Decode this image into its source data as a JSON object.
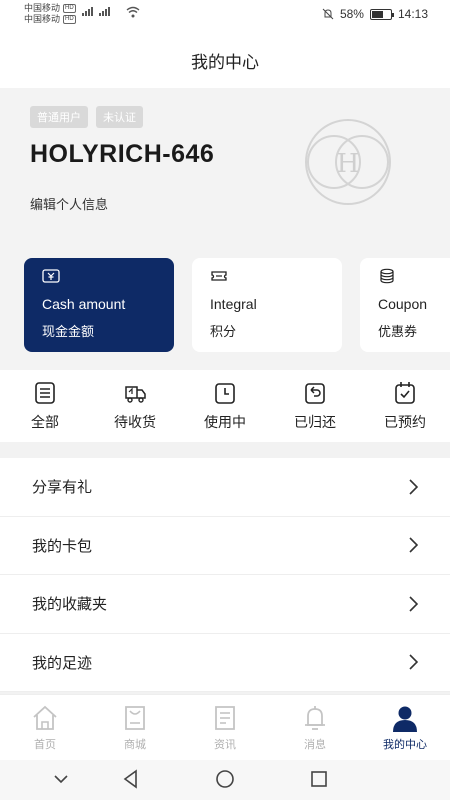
{
  "status_bar": {
    "carrier_1": "中国移动",
    "carrier_2": "中国移动",
    "hd": "HD",
    "net": "4G",
    "battery_percent": "58%",
    "time": "14:13"
  },
  "header": {
    "title": "我的中心"
  },
  "profile": {
    "tags": [
      "普通用户",
      "未认证"
    ],
    "username": "HOLYRICH-646",
    "edit_label": "编辑个人信息",
    "logo_letter": "H"
  },
  "cards": [
    {
      "en": "Cash amount",
      "cn": "现金金额",
      "icon": "yen-ticket-icon",
      "active": true
    },
    {
      "en": "Integral",
      "cn": "积分",
      "icon": "ticket-icon",
      "active": false
    },
    {
      "en": "Coupon",
      "cn": "优惠券",
      "icon": "coins-icon",
      "active": false
    }
  ],
  "orders": [
    {
      "label": "全部",
      "icon": "list-icon"
    },
    {
      "label": "待收货",
      "icon": "truck-icon"
    },
    {
      "label": "使用中",
      "icon": "clock-icon"
    },
    {
      "label": "已归还",
      "icon": "return-icon"
    },
    {
      "label": "已预约",
      "icon": "calendar-check-icon"
    }
  ],
  "menu": [
    {
      "label": "分享有礼"
    },
    {
      "label": "我的卡包"
    },
    {
      "label": "我的收藏夹"
    },
    {
      "label": "我的足迹"
    }
  ],
  "bottom_nav": [
    {
      "label": "首页",
      "icon": "home-icon"
    },
    {
      "label": "商城",
      "icon": "shopping-bag-icon"
    },
    {
      "label": "资讯",
      "icon": "news-icon"
    },
    {
      "label": "消息",
      "icon": "bell-icon"
    },
    {
      "label": "我的中心",
      "icon": "user-icon",
      "active": true
    }
  ],
  "colors": {
    "accent": "#0e2a66",
    "inactive": "#b0b0b0"
  }
}
